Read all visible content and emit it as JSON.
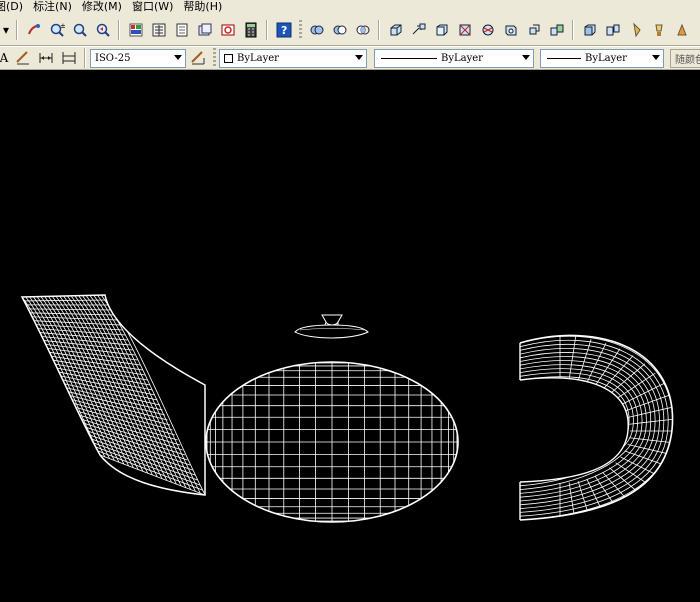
{
  "menu": {
    "items": [
      {
        "label": "图(D)"
      },
      {
        "label": "标注(N)"
      },
      {
        "label": "修改(M)"
      },
      {
        "label": "窗口(W)"
      },
      {
        "label": "帮助(H)"
      }
    ]
  },
  "toolbar_standard": {
    "icons": [
      "pan-realtime-icon",
      "zoom-realtime-icon",
      "zoom-window-icon",
      "zoom-previous-icon",
      "properties-icon",
      "design-center-icon",
      "tool-palettes-icon",
      "sheet-set-icon",
      "markup-icon",
      "quickcalc-icon",
      "help-icon",
      "union-icon",
      "subtract-icon",
      "intersect-icon",
      "box-icon",
      "sphere-icon",
      "cylinder-icon",
      "cone-icon",
      "wedge-icon",
      "torus-icon",
      "extrude-icon",
      "revolve-icon",
      "slice-icon",
      "section-icon",
      "interference-icon",
      "light-icon",
      "render-icon"
    ]
  },
  "toolbar_properties": {
    "dimstyle_value": "ISO-25",
    "color_value": "ByLayer",
    "linetype_value": "ByLayer",
    "lineweight_value": "ByLayer",
    "plotstyle_value": "随颜色"
  },
  "colors": {
    "chrome": "#ece9d8",
    "canvas": "#000000",
    "wire": "#ffffff"
  }
}
